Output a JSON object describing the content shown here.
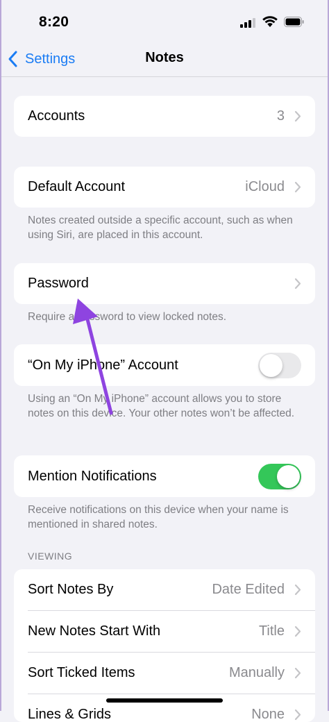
{
  "status_bar": {
    "time": "8:20"
  },
  "nav": {
    "back_label": "Settings",
    "title": "Notes"
  },
  "accounts": {
    "label": "Accounts",
    "value": "3"
  },
  "default_account": {
    "label": "Default Account",
    "value": "iCloud",
    "footnote": "Notes created outside a specific account, such as when using Siri, are placed in this account."
  },
  "password": {
    "label": "Password",
    "footnote": "Require a password to view locked notes."
  },
  "on_my_iphone": {
    "label": "“On My iPhone” Account",
    "enabled": false,
    "footnote": "Using an “On My iPhone” account allows you to store notes on this device. Your other notes won’t be affected."
  },
  "mention_notifications": {
    "label": "Mention Notifications",
    "enabled": true,
    "footnote": "Receive notifications on this device when your name is mentioned in shared notes."
  },
  "viewing": {
    "header": "VIEWING",
    "rows": [
      {
        "label": "Sort Notes By",
        "value": "Date Edited"
      },
      {
        "label": "New Notes Start With",
        "value": "Title"
      },
      {
        "label": "Sort Ticked Items",
        "value": "Manually"
      },
      {
        "label": "Lines & Grids",
        "value": "None"
      }
    ]
  },
  "colors": {
    "accent": "#1a7cf4",
    "toggle_on": "#34c759",
    "annotation_arrow": "#8e44e0"
  },
  "icons": [
    "chevron-left-icon",
    "chevron-right-icon",
    "cellular-signal-icon",
    "wifi-icon",
    "battery-icon",
    "annotation-arrow-icon"
  ]
}
